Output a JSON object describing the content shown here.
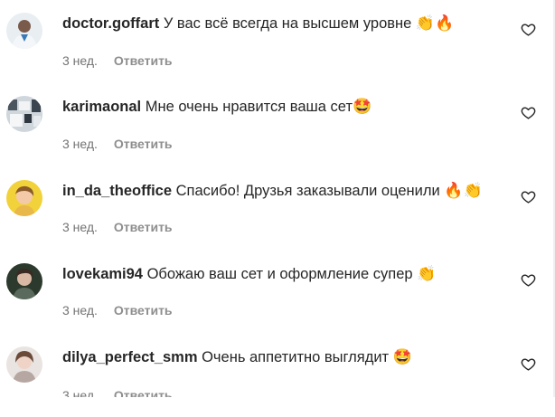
{
  "comments": [
    {
      "username": "doctor.goffart",
      "text": "У вас всё всегда на высшем уровне",
      "emoji": "👏🔥",
      "time": "3 нед.",
      "reply_label": "Ответить",
      "avatar": "avatar-doctor"
    },
    {
      "username": "karimaonal",
      "text": "Мне очень нравится ваша сет",
      "emoji": "🤩",
      "time": "3 нед.",
      "reply_label": "Ответить",
      "avatar": "avatar-karima"
    },
    {
      "username": "in_da_theoffice",
      "text": "Спасибо! Друзья заказывали оценили",
      "emoji": "🔥👏",
      "time": "3 нед.",
      "reply_label": "Ответить",
      "avatar": "avatar-office"
    },
    {
      "username": "lovekami94",
      "text": "Обожаю ваш сет и оформление супер",
      "emoji": "👏",
      "time": "3 нед.",
      "reply_label": "Ответить",
      "avatar": "avatar-kami"
    },
    {
      "username": "dilya_perfect_smm",
      "text": "Очень аппетитно выглядит",
      "emoji": "🤩",
      "time": "3 нед.",
      "reply_label": "Ответить",
      "avatar": "avatar-dilya"
    }
  ],
  "icons": {
    "like": "heart-outline-icon"
  },
  "colors": {
    "text": "#262626",
    "secondary": "#737373"
  }
}
